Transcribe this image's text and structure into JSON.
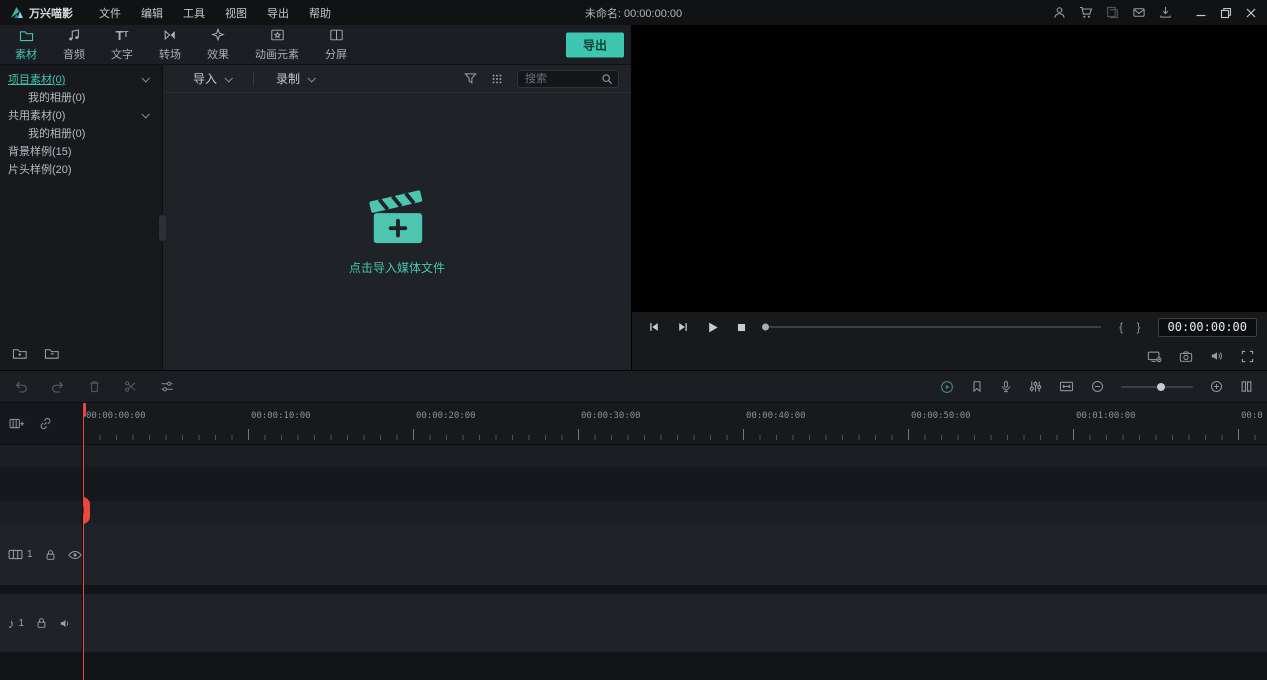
{
  "colors": {
    "accent": "#45C5AE",
    "playhead": "#E8483F",
    "export_button_bg": "#3FC6B1"
  },
  "menubar": {
    "logo_text": "万兴喵影",
    "items": [
      {
        "label": "文件"
      },
      {
        "label": "编辑"
      },
      {
        "label": "工具"
      },
      {
        "label": "视图"
      },
      {
        "label": "导出"
      },
      {
        "label": "帮助"
      }
    ],
    "project_title": "未命名: 00:00:00:00"
  },
  "tabbar": {
    "tabs": [
      {
        "label": "素材",
        "icon": "folder-icon",
        "active": true
      },
      {
        "label": "音频",
        "icon": "music-note-icon"
      },
      {
        "label": "文字",
        "icon": "text-icon"
      },
      {
        "label": "转场",
        "icon": "transition-icon"
      },
      {
        "label": "效果",
        "icon": "effects-icon"
      },
      {
        "label": "动画元素",
        "icon": "elements-icon"
      },
      {
        "label": "分屏",
        "icon": "splitscreen-icon"
      }
    ],
    "export_label": "导出"
  },
  "library": {
    "items": [
      {
        "label": "项目素材(0)",
        "selected": true
      },
      {
        "label": "我的相册(0)"
      },
      {
        "label": "共用素材(0)"
      },
      {
        "label": "我的相册(0)"
      },
      {
        "label": "背景样例(15)"
      },
      {
        "label": "片头样例(20)"
      }
    ]
  },
  "media": {
    "import_label": "导入",
    "record_label": "录制",
    "search_placeholder": "搜索",
    "empty_hint": "点击导入媒体文件"
  },
  "preview": {
    "braces": "{ }",
    "timecode": "00:00:00:00"
  },
  "timeline": {
    "ruler_labels": [
      "00:00:00:00",
      "00:00:10:00",
      "00:00:20:00",
      "00:00:30:00",
      "00:00:40:00",
      "00:00:50:00",
      "00:01:00:00",
      "00:0"
    ],
    "video_track_number": "1",
    "audio_track_number": "1"
  }
}
